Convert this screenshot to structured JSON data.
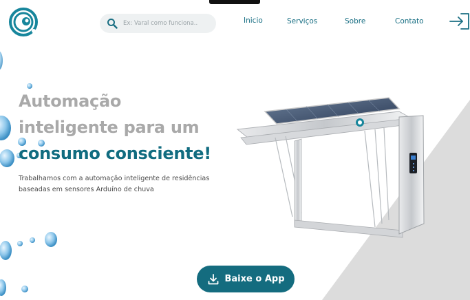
{
  "header": {
    "logo_icon": "water-drop-logo-icon",
    "search": {
      "placeholder": "Ex: Varal como funciona..",
      "value": "",
      "icon": "search-icon"
    },
    "nav": {
      "home": "Inicio",
      "services": "Serviços",
      "about": "Sobre",
      "contact": "Contato"
    },
    "login_icon": "login-arrow-icon"
  },
  "hero": {
    "title_line1": "Automação",
    "title_line2": "inteligente para um",
    "title_line3": "consumo consciente!",
    "subtitle": "Trabalhamos com a automação inteligente de residências baseadas em sensores Arduíno de chuva",
    "cta_label": "Baixe o App",
    "cta_icon": "download-icon",
    "product_image": "automated-clothesline-solar-panel-image"
  },
  "colors": {
    "brand_teal": "#146c7f",
    "title_gray": "#a9a9a9",
    "diagonal_gray": "#d9d9d9",
    "droplet_blue": "#5aa9d6"
  }
}
